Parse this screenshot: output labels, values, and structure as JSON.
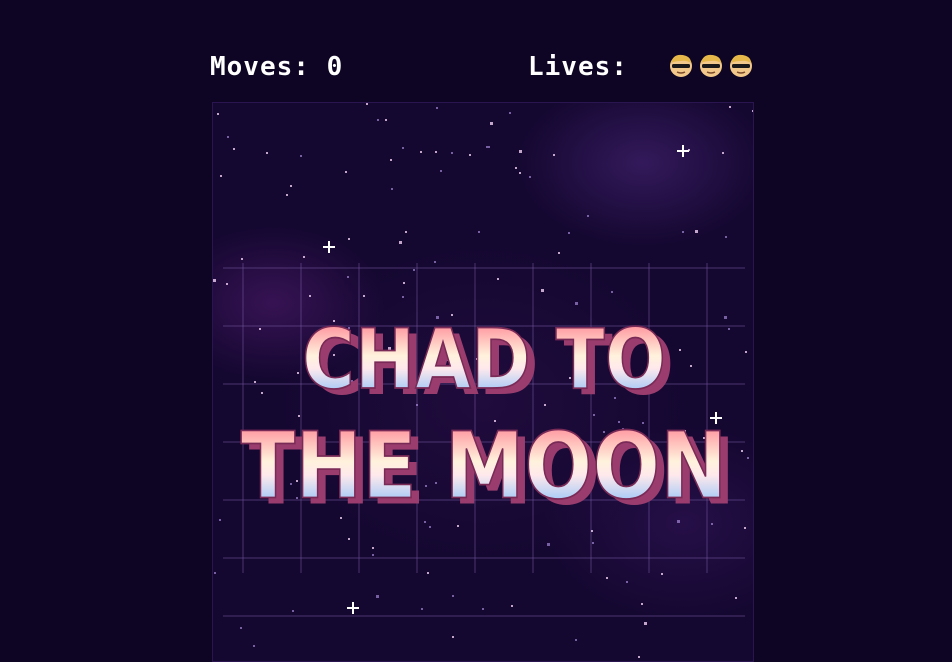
{
  "hud": {
    "moves_label": "Moves:",
    "moves_value": "0",
    "lives_label": "Lives:",
    "lives_count": 3,
    "life_icon": "chad-face-icon"
  },
  "splash": {
    "title_line1": "CHAD TO",
    "title_line2": "THE MOON"
  },
  "colors": {
    "background": "#0e0524",
    "title_top": "#ff7a8a",
    "title_mid": "#fff4e0",
    "title_bottom": "#6fb8ff",
    "title_shadow": "#b04a7a"
  }
}
